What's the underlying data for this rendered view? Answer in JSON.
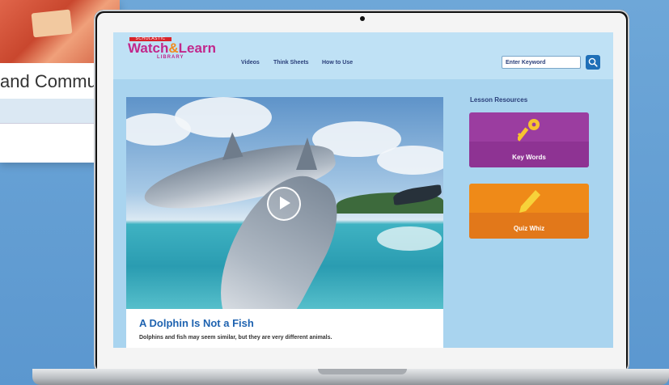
{
  "background_card": {
    "title": "and Communi"
  },
  "site": {
    "brand_badge": "SCHOLASTIC",
    "logo_part1": "Watch",
    "logo_amp": "&",
    "logo_part2": "Learn",
    "logo_sub": "LIBRARY"
  },
  "nav": {
    "items": [
      "Videos",
      "Think Sheets",
      "How to Use"
    ]
  },
  "search": {
    "placeholder": "Enter Keyword"
  },
  "video": {
    "title": "A Dolphin Is Not a Fish",
    "description": "Dolphins and fish may seem similar, but they are very different animals."
  },
  "resources": {
    "heading": "Lesson Resources",
    "items": [
      {
        "label": "Key Words",
        "icon": "key-icon",
        "color": "#9b3da0"
      },
      {
        "label": "Quiz Whiz",
        "icon": "pencil-icon",
        "color": "#ef8a18"
      }
    ]
  },
  "colors": {
    "brand_magenta": "#c2278b",
    "link_blue": "#1f63b0",
    "screen_bg": "#a9d4ef"
  }
}
